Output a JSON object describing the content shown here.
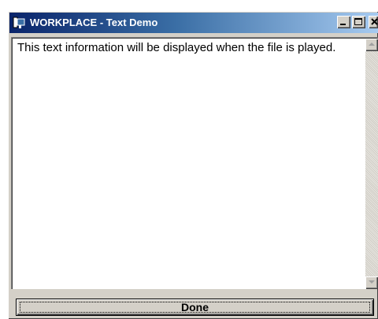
{
  "window": {
    "title": "WORKPLACE - Text Demo",
    "icon": "app-icon",
    "controls": {
      "minimize_icon": "minimize-icon",
      "maximize_icon": "maximize-icon",
      "close_icon": "close-icon"
    }
  },
  "content": {
    "message": "This text information will be displayed when the file is played."
  },
  "footer": {
    "done_label": "Done"
  },
  "colors": {
    "titlebar_start": "#0a246a",
    "titlebar_end": "#a6caf0",
    "face": "#d4d0c8"
  }
}
